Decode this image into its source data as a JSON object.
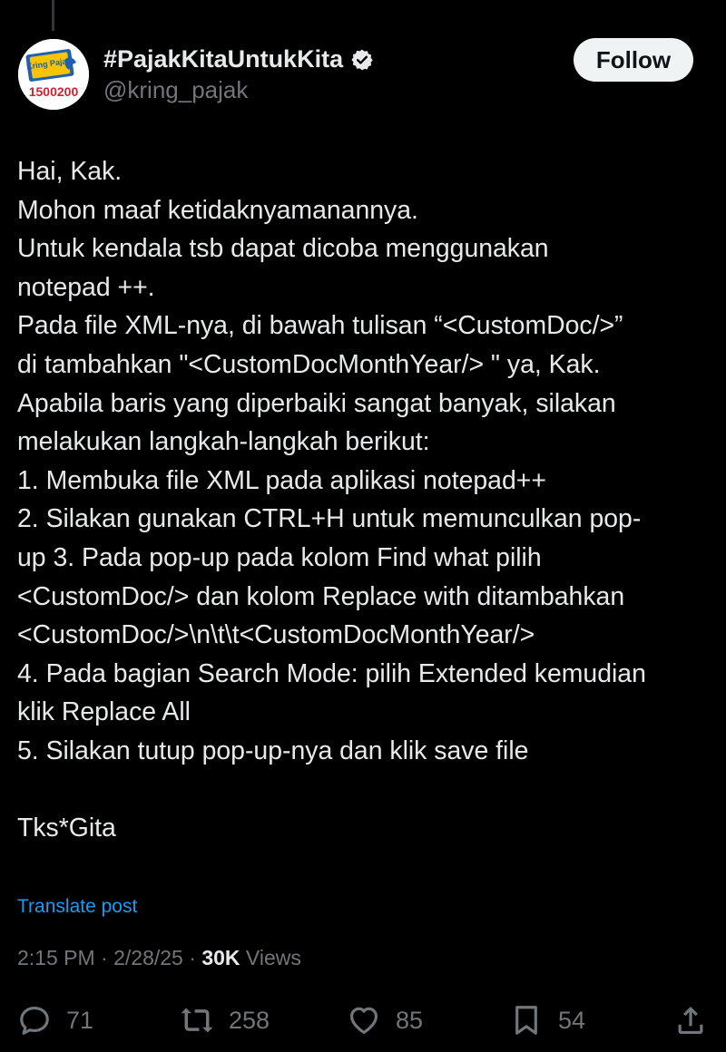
{
  "author": {
    "display_name": "#PajakKitaUntukKita",
    "handle": "@kring_pajak",
    "avatar_text_top": "Kring Pajak",
    "avatar_number": "1500200",
    "verified_color": "#e7e9ea"
  },
  "follow_label": "Follow",
  "tweet_lines": [
    "Hai, Kak.",
    "Mohon maaf ketidaknyamanannya.",
    "Untuk kendala tsb dapat dicoba menggunakan",
    "notepad ++.",
    "Pada file XML-nya, di bawah tulisan “<CustomDoc/>”",
    "di tambahkan \"<CustomDocMonthYear/> \" ya, Kak.",
    "Apabila baris yang diperbaiki sangat banyak, silakan",
    "melakukan langkah-langkah berikut:",
    "1. Membuka file XML pada aplikasi notepad++",
    "2. Silakan gunakan CTRL+H untuk memunculkan pop-",
    "up 3. Pada pop-up pada kolom Find what pilih",
    "<CustomDoc/> dan kolom Replace with ditambahkan",
    "<CustomDoc/>\\n\\t\\t<CustomDocMonthYear/>",
    "4. Pada bagian Search Mode: pilih Extended kemudian",
    "klik Replace All",
    "5. Silakan tutup pop-up-nya dan klik save file",
    "",
    "Tks*Gita"
  ],
  "translate_label": "Translate post",
  "meta": {
    "time": "2:15 PM",
    "separator": "·",
    "date": "2/28/25",
    "views_count": "30K",
    "views_label": "Views"
  },
  "actions": {
    "replies": "71",
    "reposts": "258",
    "likes": "85",
    "bookmarks": "54"
  },
  "colors": {
    "background": "#000000",
    "text": "#e7e9ea",
    "secondary": "#71767b",
    "link": "#1d9bf0",
    "avatar_yellow": "#f6c400",
    "avatar_blue": "#1f5fb4",
    "avatar_red": "#d3202f"
  }
}
